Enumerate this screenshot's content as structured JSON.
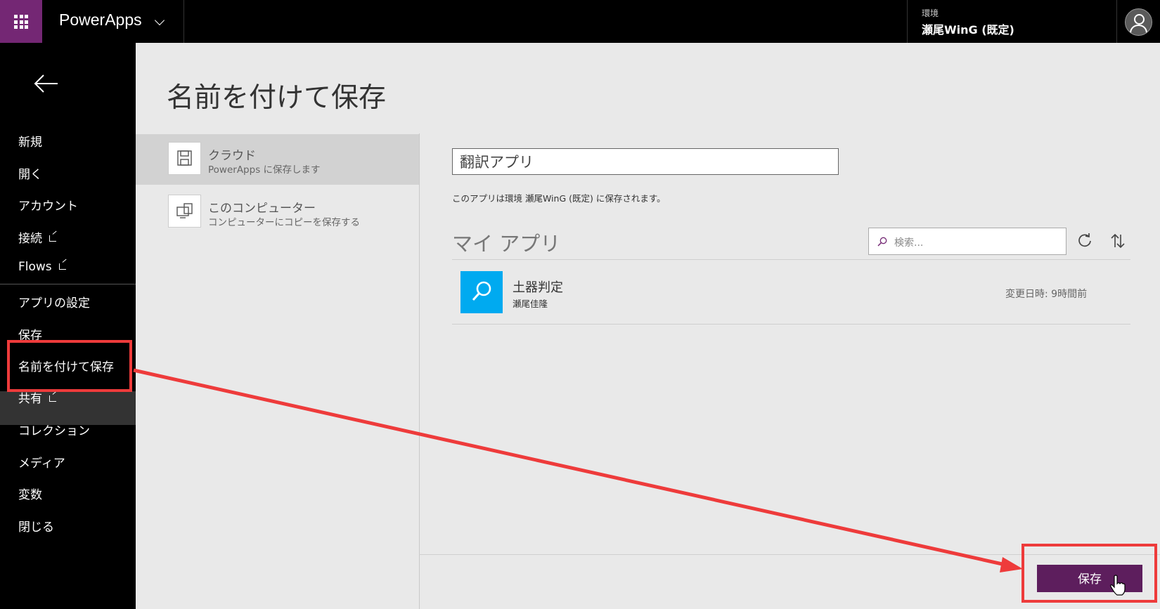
{
  "topbar": {
    "brand": "PowerApps",
    "environment_label": "環境",
    "environment_name": "瀬尾WinG (既定)"
  },
  "sidebar": {
    "items": [
      {
        "label": "新規",
        "external": false
      },
      {
        "label": "開く",
        "external": false
      },
      {
        "label": "アカウント",
        "external": false
      },
      {
        "label": "接続",
        "external": true
      },
      {
        "label": "Flows",
        "external": true
      },
      {
        "label": "アプリの設定",
        "external": false
      },
      {
        "label": "保存",
        "external": false
      },
      {
        "label": "名前を付けて保存",
        "external": false,
        "active": true
      },
      {
        "label": "共有",
        "external": true
      },
      {
        "label": "コレクション",
        "external": false
      },
      {
        "label": "メディア",
        "external": false
      },
      {
        "label": "変数",
        "external": false
      },
      {
        "label": "閉じる",
        "external": false
      }
    ]
  },
  "main": {
    "title": "名前を付けて保存",
    "options": [
      {
        "title": "クラウド",
        "subtitle": "PowerApps に保存します",
        "icon": "floppy-disk-icon",
        "selected": true
      },
      {
        "title": "このコンピューター",
        "subtitle": "コンピューターにコピーを保存する",
        "icon": "computer-icon",
        "selected": false
      }
    ],
    "app_name_value": "翻訳アプリ",
    "save_note": "このアプリは環境 瀬尾WinG (既定) に保存されます。",
    "my_apps_title": "マイ アプリ",
    "search_placeholder": "検索...",
    "apps": [
      {
        "name": "土器判定",
        "owner": "瀬尾佳隆",
        "modified": "変更日時: 9時間前"
      }
    ],
    "save_button": "保存"
  },
  "colors": {
    "accent": "#742774",
    "save_button": "#5d1e5d",
    "app_tile": "#00aaf0",
    "highlight": "#ee3b3b"
  }
}
